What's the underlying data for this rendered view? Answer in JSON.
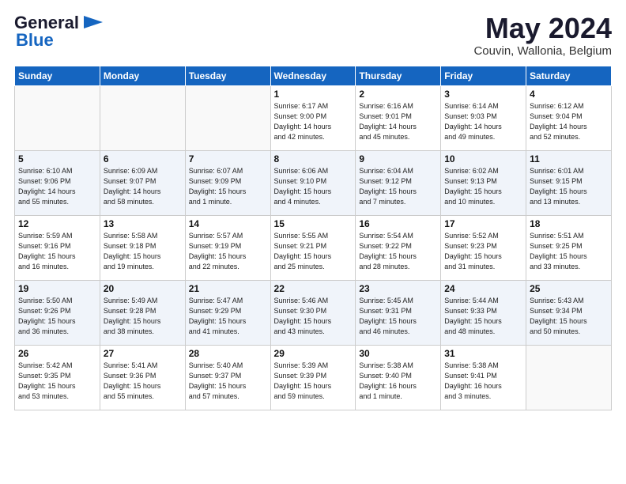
{
  "header": {
    "logo_general": "General",
    "logo_blue": "Blue",
    "month_title": "May 2024",
    "location": "Couvin, Wallonia, Belgium"
  },
  "days_of_week": [
    "Sunday",
    "Monday",
    "Tuesday",
    "Wednesday",
    "Thursday",
    "Friday",
    "Saturday"
  ],
  "weeks": [
    [
      {
        "day": "",
        "info": ""
      },
      {
        "day": "",
        "info": ""
      },
      {
        "day": "",
        "info": ""
      },
      {
        "day": "1",
        "info": "Sunrise: 6:17 AM\nSunset: 9:00 PM\nDaylight: 14 hours\nand 42 minutes."
      },
      {
        "day": "2",
        "info": "Sunrise: 6:16 AM\nSunset: 9:01 PM\nDaylight: 14 hours\nand 45 minutes."
      },
      {
        "day": "3",
        "info": "Sunrise: 6:14 AM\nSunset: 9:03 PM\nDaylight: 14 hours\nand 49 minutes."
      },
      {
        "day": "4",
        "info": "Sunrise: 6:12 AM\nSunset: 9:04 PM\nDaylight: 14 hours\nand 52 minutes."
      }
    ],
    [
      {
        "day": "5",
        "info": "Sunrise: 6:10 AM\nSunset: 9:06 PM\nDaylight: 14 hours\nand 55 minutes."
      },
      {
        "day": "6",
        "info": "Sunrise: 6:09 AM\nSunset: 9:07 PM\nDaylight: 14 hours\nand 58 minutes."
      },
      {
        "day": "7",
        "info": "Sunrise: 6:07 AM\nSunset: 9:09 PM\nDaylight: 15 hours\nand 1 minute."
      },
      {
        "day": "8",
        "info": "Sunrise: 6:06 AM\nSunset: 9:10 PM\nDaylight: 15 hours\nand 4 minutes."
      },
      {
        "day": "9",
        "info": "Sunrise: 6:04 AM\nSunset: 9:12 PM\nDaylight: 15 hours\nand 7 minutes."
      },
      {
        "day": "10",
        "info": "Sunrise: 6:02 AM\nSunset: 9:13 PM\nDaylight: 15 hours\nand 10 minutes."
      },
      {
        "day": "11",
        "info": "Sunrise: 6:01 AM\nSunset: 9:15 PM\nDaylight: 15 hours\nand 13 minutes."
      }
    ],
    [
      {
        "day": "12",
        "info": "Sunrise: 5:59 AM\nSunset: 9:16 PM\nDaylight: 15 hours\nand 16 minutes."
      },
      {
        "day": "13",
        "info": "Sunrise: 5:58 AM\nSunset: 9:18 PM\nDaylight: 15 hours\nand 19 minutes."
      },
      {
        "day": "14",
        "info": "Sunrise: 5:57 AM\nSunset: 9:19 PM\nDaylight: 15 hours\nand 22 minutes."
      },
      {
        "day": "15",
        "info": "Sunrise: 5:55 AM\nSunset: 9:21 PM\nDaylight: 15 hours\nand 25 minutes."
      },
      {
        "day": "16",
        "info": "Sunrise: 5:54 AM\nSunset: 9:22 PM\nDaylight: 15 hours\nand 28 minutes."
      },
      {
        "day": "17",
        "info": "Sunrise: 5:52 AM\nSunset: 9:23 PM\nDaylight: 15 hours\nand 31 minutes."
      },
      {
        "day": "18",
        "info": "Sunrise: 5:51 AM\nSunset: 9:25 PM\nDaylight: 15 hours\nand 33 minutes."
      }
    ],
    [
      {
        "day": "19",
        "info": "Sunrise: 5:50 AM\nSunset: 9:26 PM\nDaylight: 15 hours\nand 36 minutes."
      },
      {
        "day": "20",
        "info": "Sunrise: 5:49 AM\nSunset: 9:28 PM\nDaylight: 15 hours\nand 38 minutes."
      },
      {
        "day": "21",
        "info": "Sunrise: 5:47 AM\nSunset: 9:29 PM\nDaylight: 15 hours\nand 41 minutes."
      },
      {
        "day": "22",
        "info": "Sunrise: 5:46 AM\nSunset: 9:30 PM\nDaylight: 15 hours\nand 43 minutes."
      },
      {
        "day": "23",
        "info": "Sunrise: 5:45 AM\nSunset: 9:31 PM\nDaylight: 15 hours\nand 46 minutes."
      },
      {
        "day": "24",
        "info": "Sunrise: 5:44 AM\nSunset: 9:33 PM\nDaylight: 15 hours\nand 48 minutes."
      },
      {
        "day": "25",
        "info": "Sunrise: 5:43 AM\nSunset: 9:34 PM\nDaylight: 15 hours\nand 50 minutes."
      }
    ],
    [
      {
        "day": "26",
        "info": "Sunrise: 5:42 AM\nSunset: 9:35 PM\nDaylight: 15 hours\nand 53 minutes."
      },
      {
        "day": "27",
        "info": "Sunrise: 5:41 AM\nSunset: 9:36 PM\nDaylight: 15 hours\nand 55 minutes."
      },
      {
        "day": "28",
        "info": "Sunrise: 5:40 AM\nSunset: 9:37 PM\nDaylight: 15 hours\nand 57 minutes."
      },
      {
        "day": "29",
        "info": "Sunrise: 5:39 AM\nSunset: 9:39 PM\nDaylight: 15 hours\nand 59 minutes."
      },
      {
        "day": "30",
        "info": "Sunrise: 5:38 AM\nSunset: 9:40 PM\nDaylight: 16 hours\nand 1 minute."
      },
      {
        "day": "31",
        "info": "Sunrise: 5:38 AM\nSunset: 9:41 PM\nDaylight: 16 hours\nand 3 minutes."
      },
      {
        "day": "",
        "info": ""
      }
    ]
  ]
}
